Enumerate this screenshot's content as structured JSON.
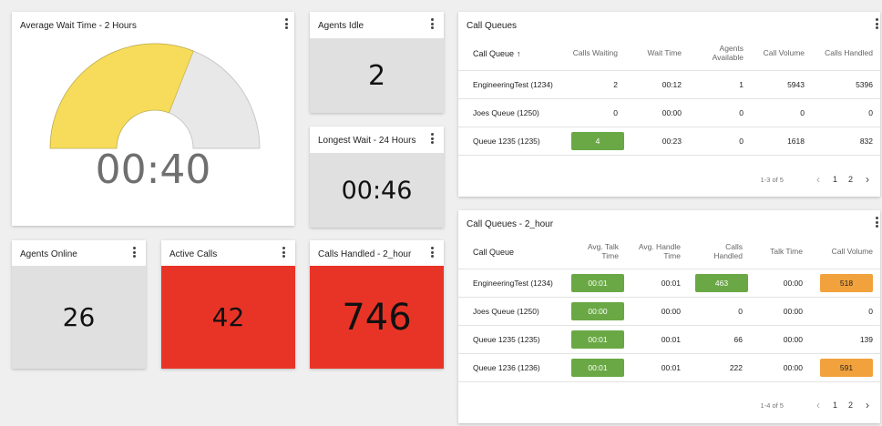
{
  "avg_wait": {
    "title": "Average Wait Time - 2 Hours",
    "value": "00:40",
    "fill_fraction": 0.62,
    "fill_color": "#f6dc5a",
    "track_color": "#e8e8e8"
  },
  "agents_idle": {
    "title": "Agents Idle",
    "value": "2"
  },
  "longest_wait": {
    "title": "Longest Wait - 24 Hours",
    "value": "00:46"
  },
  "agents_online": {
    "title": "Agents Online",
    "value": "26"
  },
  "active_calls": {
    "title": "Active Calls",
    "value": "42"
  },
  "calls_handled": {
    "title": "Calls Handled - 2_hour",
    "value": "746"
  },
  "call_queues": {
    "title": "Call Queues",
    "headers": [
      "Call Queue",
      "Calls Waiting",
      "Wait Time",
      "Agents Available",
      "Call Volume",
      "Calls Handled"
    ],
    "rows": [
      [
        "EngineeringTest (1234)",
        "2",
        "00:12",
        "1",
        "5943",
        "5396"
      ],
      [
        "Joes Queue (1250)",
        "0",
        "00:00",
        "0",
        "0",
        "0"
      ],
      [
        "Queue 1235 (1235)",
        "4",
        "00:23",
        "0",
        "1618",
        "832"
      ]
    ],
    "pager": {
      "range": "1-3 of 5",
      "pages": [
        "1",
        "2"
      ],
      "prev": "‹",
      "next": "›"
    }
  },
  "call_queues_2h": {
    "title": "Call Queues - 2_hour",
    "headers": [
      "Call Queue",
      "Avg. Talk Time",
      "Avg. Handle Time",
      "Calls Handled",
      "Talk Time",
      "Call Volume"
    ],
    "rows": [
      [
        "EngineeringTest (1234)",
        "00:01",
        "00:01",
        "463",
        "00:00",
        "518"
      ],
      [
        "Joes Queue (1250)",
        "00:00",
        "00:00",
        "0",
        "00:00",
        "0"
      ],
      [
        "Queue 1235 (1235)",
        "00:01",
        "00:01",
        "66",
        "00:00",
        "139"
      ],
      [
        "Queue 1236 (1236)",
        "00:01",
        "00:01",
        "222",
        "00:00",
        "591"
      ]
    ],
    "pager": {
      "range": "1-4 of 5",
      "pages": [
        "1",
        "2"
      ],
      "prev": "‹",
      "next": "›"
    }
  },
  "icons": {
    "menu": "more-vert-icon",
    "sort": "arrow-up-icon",
    "prev": "chevron-left-icon",
    "next": "chevron-right-icon"
  },
  "colors": {
    "green": "#6aa845",
    "orange": "#f2a23c",
    "red": "#e83427",
    "grey_tile": "#e0e0e0"
  }
}
